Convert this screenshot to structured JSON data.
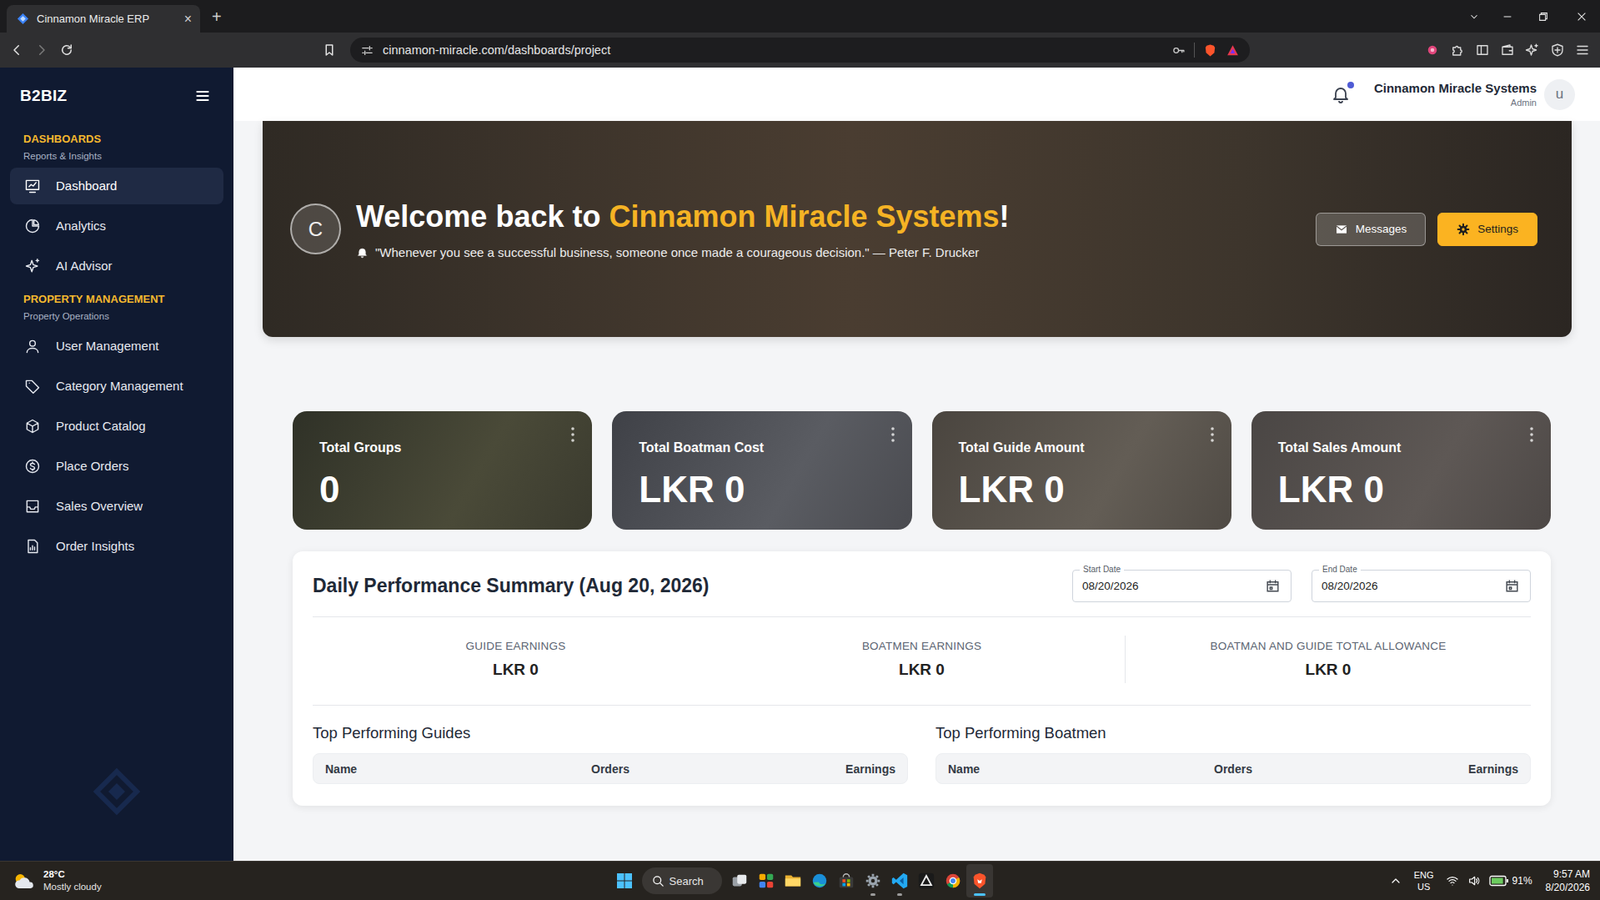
{
  "browser": {
    "tab": {
      "title": "Cinnamon Miracle ERP",
      "close": "×",
      "selected": true
    },
    "new_tab": "+",
    "url": "cinnamon-miracle.com/dashboards/project"
  },
  "sidebar": {
    "brand": "B2BIZ",
    "sections": [
      {
        "title": "DASHBOARDS",
        "subtitle": "Reports & Insights",
        "items": [
          {
            "label": "Dashboard",
            "selected": true
          },
          {
            "label": "Analytics",
            "selected": false
          },
          {
            "label": "AI Advisor",
            "selected": false
          }
        ]
      },
      {
        "title": "PROPERTY MANAGEMENT",
        "subtitle": "Property Operations",
        "items": [
          {
            "label": "User Management",
            "selected": false
          },
          {
            "label": "Category Management",
            "selected": false
          },
          {
            "label": "Product Catalog",
            "selected": false
          },
          {
            "label": "Place Orders",
            "selected": false
          },
          {
            "label": "Sales Overview",
            "selected": false
          },
          {
            "label": "Order Insights",
            "selected": false
          }
        ]
      }
    ]
  },
  "header": {
    "notifications": {
      "unread": true
    },
    "user": {
      "name": "Cinnamon Miracle Systems",
      "role": "Admin",
      "avatar": "u"
    }
  },
  "hero": {
    "avatar": "C",
    "greeting": "Welcome back to ",
    "company": "Cinnamon Miracle Systems",
    "exclaim": "!",
    "quote": "\"Whenever you see a successful business, someone once made a courageous decision.\" — Peter F. Drucker",
    "buttons": [
      {
        "label": "Messages",
        "kind": "secondary"
      },
      {
        "label": "Settings",
        "kind": "primary"
      }
    ]
  },
  "stats": [
    {
      "title": "Total Groups",
      "value": "0"
    },
    {
      "title": "Total Boatman Cost",
      "value": "LKR 0"
    },
    {
      "title": "Total Guide Amount",
      "value": "LKR 0"
    },
    {
      "title": "Total Sales Amount",
      "value": "LKR 0"
    }
  ],
  "summary": {
    "title": "Daily Performance Summary (Aug 20, 2026)",
    "dates": [
      {
        "label": "Start Date",
        "value": "08/20/2026"
      },
      {
        "label": "End Date",
        "value": "08/20/2026"
      }
    ],
    "metrics": [
      {
        "label": "GUIDE EARNINGS",
        "value": "LKR 0"
      },
      {
        "label": "BOATMEN EARNINGS",
        "value": "LKR 0"
      },
      {
        "label": "BOATMAN AND GUIDE TOTAL ALLOWANCE",
        "value": "LKR 0"
      }
    ],
    "tables": [
      {
        "title": "Top Performing Guides",
        "columns": [
          "Name",
          "Orders",
          "Earnings"
        ],
        "rows": []
      },
      {
        "title": "Top Performing Boatmen",
        "columns": [
          "Name",
          "Orders",
          "Earnings"
        ],
        "rows": []
      }
    ]
  },
  "taskbar": {
    "weather": {
      "temp": "28°C",
      "condition": "Mostly cloudy"
    },
    "search": "Search",
    "apps": [
      {
        "running": false,
        "selected": false
      },
      {
        "running": false,
        "selected": false
      },
      {
        "running": false,
        "selected": false
      },
      {
        "running": false,
        "selected": false
      },
      {
        "running": false,
        "selected": false
      },
      {
        "running": true,
        "selected": false
      },
      {
        "running": true,
        "selected": false
      },
      {
        "running": false,
        "selected": false
      },
      {
        "running": false,
        "selected": false
      },
      {
        "running": true,
        "selected": true
      }
    ],
    "tray": {
      "language": "ENG",
      "region": "US",
      "battery": "91%",
      "battery_level": 0.91,
      "time": "9:57 AM",
      "date": "8/20/2026"
    }
  }
}
